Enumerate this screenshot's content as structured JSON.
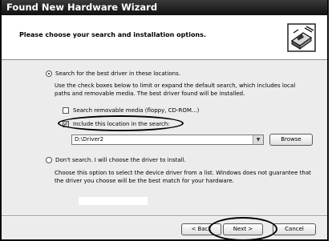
{
  "window": {
    "title": "Found New Hardware Wizard"
  },
  "header": {
    "heading": "Please choose your search and installation options.",
    "icon": "hardware-wizard-icon"
  },
  "options": {
    "search": {
      "label": "Search for the best driver in these locations.",
      "selected": true,
      "description_line1": "Use the check boxes below to limit or expand the default search, which includes local",
      "description_line2": "paths and removable media. The best driver found will be installed.",
      "removable_media": {
        "label": "Search removable media (floppy, CD-ROM...)",
        "checked": false
      },
      "include_location": {
        "label": "Include this location in the search:",
        "checked": true
      },
      "location_value": "D:\\Driver2",
      "browse_label": "Browse"
    },
    "dont_search": {
      "label": "Don't search. I will choose the driver to install.",
      "selected": false,
      "description_line1": "Choose this option to select the device driver from a list.  Windows does not guarantee that",
      "description_line2": "the driver you choose will be the best match for your hardware."
    }
  },
  "footer": {
    "back_label": "< Back",
    "next_label": "Next >",
    "cancel_label": "Cancel"
  }
}
